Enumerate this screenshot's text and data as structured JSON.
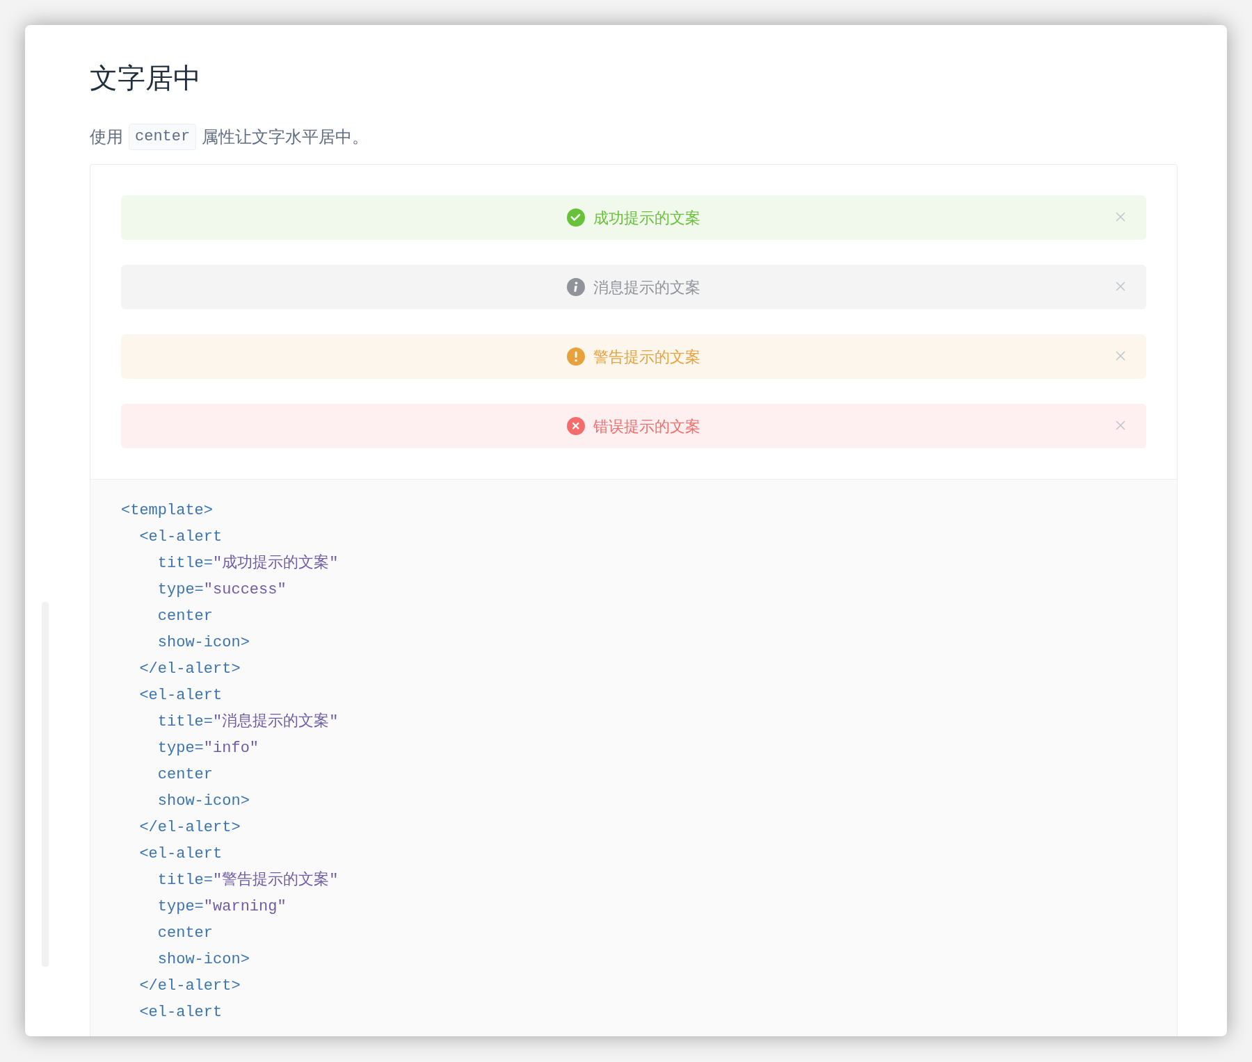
{
  "heading": "文字居中",
  "description": {
    "before": "使用",
    "code": "center",
    "after": "属性让文字水平居中。"
  },
  "alerts": [
    {
      "kind": "success",
      "title": "成功提示的文案"
    },
    {
      "kind": "info",
      "title": "消息提示的文案"
    },
    {
      "kind": "warning",
      "title": "警告提示的文案"
    },
    {
      "kind": "error",
      "title": "错误提示的文案"
    }
  ],
  "code_lines": [
    [
      {
        "kind": "tag",
        "text": "<template>"
      }
    ],
    [
      {
        "kind": "tag",
        "text": "  <el-alert"
      }
    ],
    [
      {
        "kind": "tag",
        "text": "    title="
      },
      {
        "kind": "string",
        "text": "\"成功提示的文案\""
      }
    ],
    [
      {
        "kind": "tag",
        "text": "    type="
      },
      {
        "kind": "string",
        "text": "\"success\""
      }
    ],
    [
      {
        "kind": "tag",
        "text": "    center"
      }
    ],
    [
      {
        "kind": "tag",
        "text": "    show-icon>"
      }
    ],
    [
      {
        "kind": "tag",
        "text": "  </el-alert>"
      }
    ],
    [
      {
        "kind": "tag",
        "text": "  <el-alert"
      }
    ],
    [
      {
        "kind": "tag",
        "text": "    title="
      },
      {
        "kind": "string",
        "text": "\"消息提示的文案\""
      }
    ],
    [
      {
        "kind": "tag",
        "text": "    type="
      },
      {
        "kind": "string",
        "text": "\"info\""
      }
    ],
    [
      {
        "kind": "tag",
        "text": "    center"
      }
    ],
    [
      {
        "kind": "tag",
        "text": "    show-icon>"
      }
    ],
    [
      {
        "kind": "tag",
        "text": "  </el-alert>"
      }
    ],
    [
      {
        "kind": "tag",
        "text": "  <el-alert"
      }
    ],
    [
      {
        "kind": "tag",
        "text": "    title="
      },
      {
        "kind": "string",
        "text": "\"警告提示的文案\""
      }
    ],
    [
      {
        "kind": "tag",
        "text": "    type="
      },
      {
        "kind": "string",
        "text": "\"warning\""
      }
    ],
    [
      {
        "kind": "tag",
        "text": "    center"
      }
    ],
    [
      {
        "kind": "tag",
        "text": "    show-icon>"
      }
    ],
    [
      {
        "kind": "tag",
        "text": "  </el-alert>"
      }
    ],
    [
      {
        "kind": "tag",
        "text": "  <el-alert"
      }
    ]
  ]
}
